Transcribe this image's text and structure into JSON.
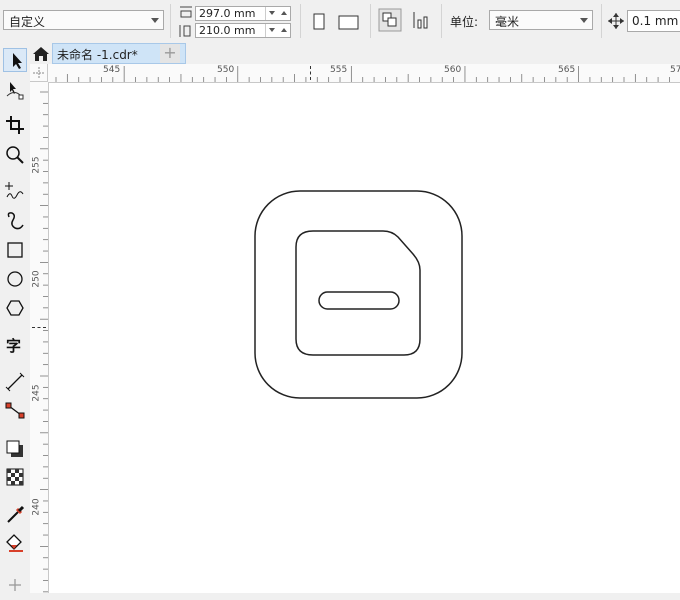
{
  "propbar": {
    "page_size": "自定义",
    "width_value": "297.0 mm",
    "height_value": "210.0 mm",
    "units_label": "单位:",
    "units_value": "毫米",
    "nudge_value": "0.1 mm"
  },
  "tabs": {
    "document_tab": "未命名 -1.cdr*",
    "add_tab": "+"
  },
  "hruler_labels": [
    "545",
    "550",
    "555",
    "560",
    "565",
    "57"
  ],
  "vruler_labels": [
    "255",
    "250",
    "245",
    "240"
  ],
  "toolbox": {
    "items": [
      "pick-tool",
      "shape-tool",
      "crop-tool",
      "zoom-tool",
      "freehand-tool",
      "artistic-media-tool",
      "rectangle-tool",
      "ellipse-tool",
      "polygon-tool",
      "text-tool",
      "parallel-dimension-tool",
      "connector-tool",
      "drop-shadow-tool",
      "transparency-tool",
      "eyedropper-tool",
      "interactive-fill-tool",
      "add-tool"
    ]
  },
  "colors": {
    "tab_active": "#cfe4f7",
    "drawing_stroke": "#222222"
  }
}
